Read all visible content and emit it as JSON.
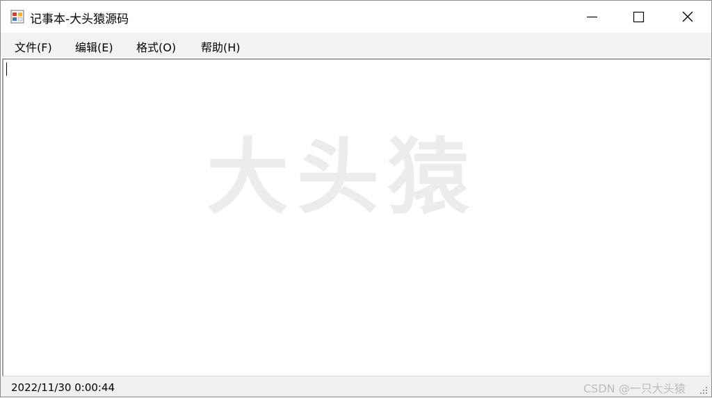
{
  "window": {
    "title": "记事本-大头猿源码",
    "icons": {
      "app": "notepad-app-icon",
      "minimize": "minimize-icon",
      "maximize": "maximize-icon",
      "close": "close-icon",
      "resize": "resize-grip-icon"
    }
  },
  "menu": {
    "items": [
      {
        "label": "文件(F)"
      },
      {
        "label": "编辑(E)"
      },
      {
        "label": "格式(O)"
      },
      {
        "label": "帮助(H)"
      }
    ]
  },
  "editor": {
    "content": "",
    "watermark": "大头猿"
  },
  "statusbar": {
    "datetime": "2022/11/30 0:00:44",
    "credit": "CSDN @一只大头猿"
  }
}
